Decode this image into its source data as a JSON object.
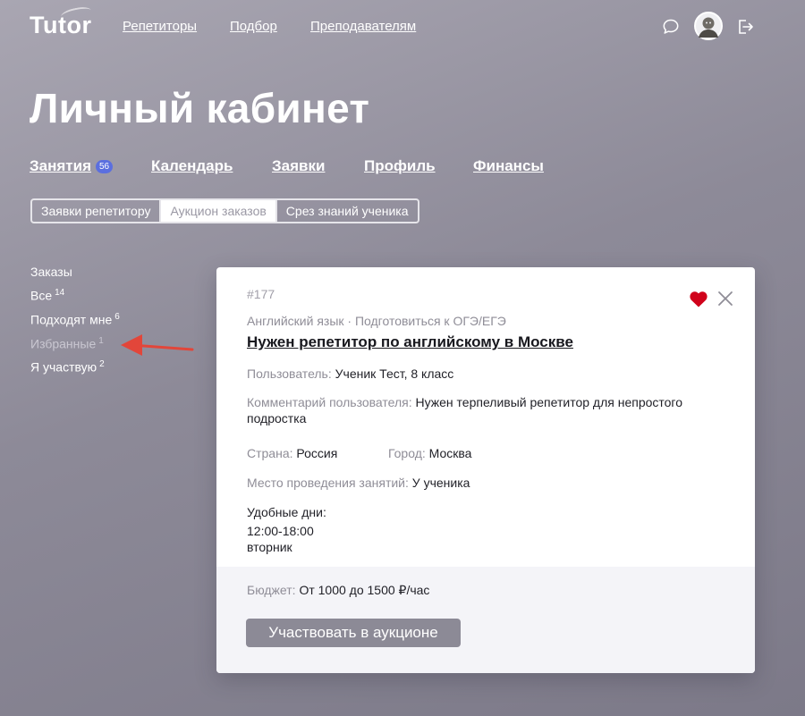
{
  "brand": {
    "name": "Tutor"
  },
  "nav": {
    "links": [
      "Репетиторы",
      "Подбор",
      "Преподавателям"
    ]
  },
  "header_icons": [
    "chat-bubble-icon",
    "avatar",
    "logout-icon"
  ],
  "page_title": "Личный кабинет",
  "tabs": [
    {
      "label": "Занятия",
      "badge": "56"
    },
    {
      "label": "Календарь"
    },
    {
      "label": "Заявки"
    },
    {
      "label": "Профиль"
    },
    {
      "label": "Финансы"
    }
  ],
  "subtabs": [
    {
      "label": "Заявки репетитору",
      "active": false
    },
    {
      "label": "Аукцион заказов",
      "active": true
    },
    {
      "label": "Срез знаний ученика",
      "active": false
    }
  ],
  "sidebar": {
    "heading": "Заказы",
    "items": [
      {
        "label": "Все",
        "count": "14"
      },
      {
        "label": "Подходят мне",
        "count": "6"
      },
      {
        "label": "Избранные",
        "count": "1"
      },
      {
        "label": "Я участвую",
        "count": "2"
      }
    ]
  },
  "card": {
    "number": "#177",
    "subject": "Английский язык · Подготовиться к ОГЭ/ЕГЭ",
    "title": "Нужен репетитор по английскому в Москве",
    "user_label": "Пользователь:",
    "user_value": "Ученик Тест, 8 класс",
    "comment_label": "Комментарий пользователя:",
    "comment_value": "Нужен терпеливый репетитор для непростого подростка",
    "country_label": "Страна:",
    "country_value": "Россия",
    "city_label": "Город:",
    "city_value": "Москва",
    "place_label": "Место проведения занятий:",
    "place_value": "У ученика",
    "days_label": "Удобные дни:",
    "days_time": "12:00-18:00",
    "days_day": "вторник",
    "budget_label": "Бюджет:",
    "budget_value": "От 1000 до 1500 ₽/час",
    "cta_label": "Участвовать в аукционе",
    "favorited": true
  },
  "colors": {
    "badge": "#5b6fdf",
    "heart": "#d0021b",
    "arrow": "#e2463a",
    "cta_bg": "#8c8a96"
  }
}
